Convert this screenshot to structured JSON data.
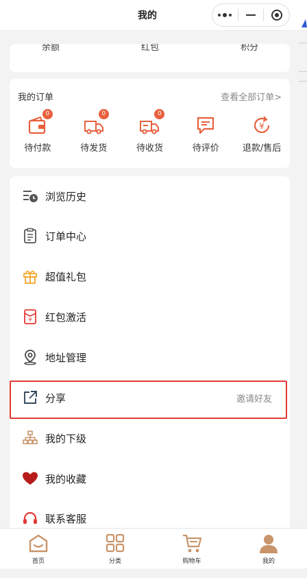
{
  "window": {
    "title": "我的"
  },
  "capsule": {
    "more_icon": "more-dots-icon",
    "minimize_icon": "minimize-icon",
    "close_icon": "target-close-icon"
  },
  "stats": {
    "items": [
      "余额",
      "红包",
      "积分"
    ]
  },
  "orders": {
    "title": "我的订单",
    "view_all": "查看全部订单>",
    "items": [
      {
        "label": "待付款",
        "icon": "wallet-icon",
        "badge": "0"
      },
      {
        "label": "待发货",
        "icon": "truck-icon",
        "badge": "0"
      },
      {
        "label": "待收货",
        "icon": "delivery-truck-icon",
        "badge": "0"
      },
      {
        "label": "待评价",
        "icon": "comment-icon",
        "badge": ""
      },
      {
        "label": "退款/售后",
        "icon": "refund-icon",
        "badge": ""
      }
    ]
  },
  "menu": {
    "items": [
      {
        "label": "浏览历史",
        "icon": "history-icon"
      },
      {
        "label": "订单中心",
        "icon": "clipboard-icon"
      },
      {
        "label": "超值礼包",
        "icon": "gift-icon"
      },
      {
        "label": "红包激活",
        "icon": "red-envelope-icon"
      },
      {
        "label": "地址管理",
        "icon": "location-pin-icon"
      },
      {
        "label": "分享",
        "icon": "share-icon",
        "right": "邀请好友"
      },
      {
        "label": "我的下级",
        "icon": "org-chart-icon"
      },
      {
        "label": "我的收藏",
        "icon": "heart-icon"
      },
      {
        "label": "联系客服",
        "icon": "headset-icon"
      }
    ]
  },
  "tabbar": {
    "items": [
      {
        "label": "首页",
        "icon": "home-icon"
      },
      {
        "label": "分类",
        "icon": "category-grid-icon"
      },
      {
        "label": "购物车",
        "icon": "cart-icon"
      },
      {
        "label": "我的",
        "icon": "user-icon",
        "active": true
      }
    ]
  },
  "colors": {
    "accent": "#e8603d",
    "brand_icon": "#c8946a",
    "highlight_border": "#e53935",
    "background": "#f3f3f3"
  }
}
